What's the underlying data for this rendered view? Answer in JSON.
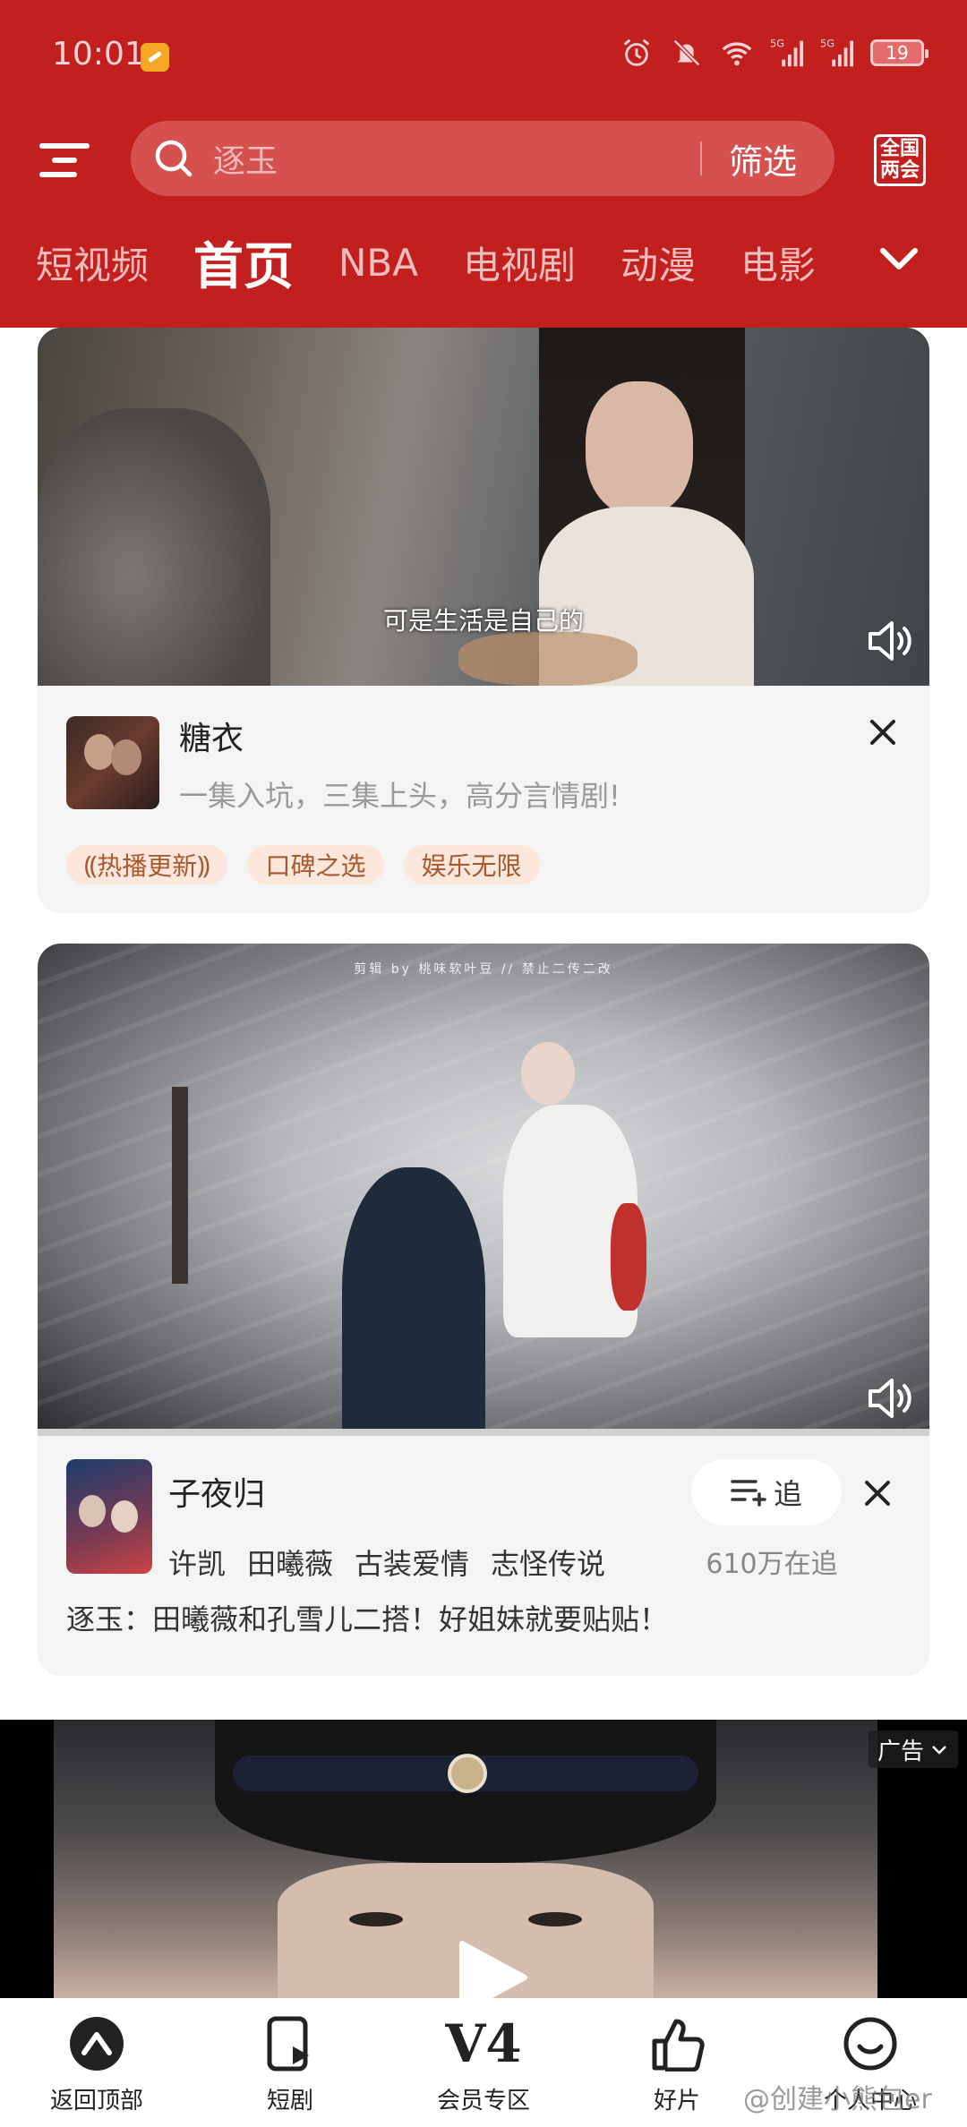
{
  "status_bar": {
    "time": "10:01",
    "battery": "19"
  },
  "header": {
    "search_placeholder": "逐玉",
    "filter_label": "筛选",
    "lianghui_badge": "全国两会"
  },
  "tabs": [
    {
      "label": "短视频",
      "active": false
    },
    {
      "label": "首页",
      "active": true
    },
    {
      "label": "NBA",
      "active": false
    },
    {
      "label": "电视剧",
      "active": false
    },
    {
      "label": "动漫",
      "active": false
    },
    {
      "label": "电影",
      "active": false
    }
  ],
  "card1": {
    "subtitle": "可是生活是自己的",
    "title": "糖衣",
    "desc": "一集入坑，三集上头，高分言情剧!",
    "tags": [
      "热播更新",
      "口碑之选",
      "娱乐无限"
    ]
  },
  "card2": {
    "video_caption": "剪辑 by 桃味软叶豆 // 禁止二传二改",
    "title": "子夜归",
    "meta": [
      "许凯",
      "田曦薇",
      "古装爱情",
      "志怪传说"
    ],
    "follow_label": "追",
    "follow_count": "610万在追",
    "headline": "逐玉：田曦薇和孔雪儿二搭！好姐妹就要贴贴！"
  },
  "ad": {
    "badge": "广告"
  },
  "bottom_nav": [
    {
      "label": "返回顶部",
      "icon": "back-to-top-icon"
    },
    {
      "label": "短剧",
      "icon": "short-drama-icon"
    },
    {
      "label": "会员专区",
      "icon": "v4-vip-icon",
      "glyph": "V4"
    },
    {
      "label": "好片",
      "icon": "thumbs-up-icon"
    },
    {
      "label": "个人中心",
      "icon": "smile-icon"
    }
  ],
  "watermark": "@创建小熊包er",
  "colors": {
    "brand_red": "#c1201f",
    "tag_bg": "#fbe7dc",
    "tag_text": "#a75a2e"
  }
}
